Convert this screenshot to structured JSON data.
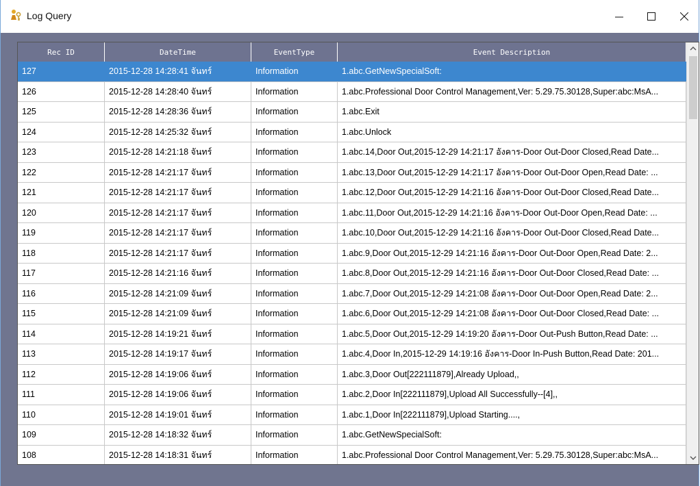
{
  "window": {
    "title": "Log Query",
    "icon": "key-person-icon",
    "controls": {
      "minimize": "—",
      "maximize": "☐",
      "close": "✕"
    }
  },
  "grid": {
    "columns": [
      "Rec ID",
      "DateTime",
      "EventType",
      "Event Description"
    ],
    "selected_index": 0,
    "rows": [
      {
        "rec_id": "127",
        "datetime": "2015-12-28 14:28:41 จันทร์",
        "event_type": "Information",
        "description": "1.abc.GetNewSpecialSoft:"
      },
      {
        "rec_id": "126",
        "datetime": "2015-12-28 14:28:40 จันทร์",
        "event_type": "Information",
        "description": "1.abc.Professional Door Control Management,Ver: 5.29.75.30128,Super:abc:MsA..."
      },
      {
        "rec_id": "125",
        "datetime": "2015-12-28 14:28:36 จันทร์",
        "event_type": "Information",
        "description": "1.abc.Exit"
      },
      {
        "rec_id": "124",
        "datetime": "2015-12-28 14:25:32 จันทร์",
        "event_type": "Information",
        "description": "1.abc.Unlock"
      },
      {
        "rec_id": "123",
        "datetime": "2015-12-28 14:21:18 จันทร์",
        "event_type": "Information",
        "description": "1.abc.14,Door Out,2015-12-29 14:21:17 อังคาร-Door Out-Door Closed,Read Date..."
      },
      {
        "rec_id": "122",
        "datetime": "2015-12-28 14:21:17 จันทร์",
        "event_type": "Information",
        "description": "1.abc.13,Door Out,2015-12-29 14:21:17 อังคาร-Door Out-Door Open,Read Date: ..."
      },
      {
        "rec_id": "121",
        "datetime": "2015-12-28 14:21:17 จันทร์",
        "event_type": "Information",
        "description": "1.abc.12,Door Out,2015-12-29 14:21:16 อังคาร-Door Out-Door Closed,Read Date..."
      },
      {
        "rec_id": "120",
        "datetime": "2015-12-28 14:21:17 จันทร์",
        "event_type": "Information",
        "description": "1.abc.11,Door Out,2015-12-29 14:21:16 อังคาร-Door Out-Door Open,Read Date: ..."
      },
      {
        "rec_id": "119",
        "datetime": "2015-12-28 14:21:17 จันทร์",
        "event_type": "Information",
        "description": "1.abc.10,Door Out,2015-12-29 14:21:16 อังคาร-Door Out-Door Closed,Read Date..."
      },
      {
        "rec_id": "118",
        "datetime": "2015-12-28 14:21:17 จันทร์",
        "event_type": "Information",
        "description": "1.abc.9,Door Out,2015-12-29 14:21:16 อังคาร-Door Out-Door Open,Read Date: 2..."
      },
      {
        "rec_id": "117",
        "datetime": "2015-12-28 14:21:16 จันทร์",
        "event_type": "Information",
        "description": "1.abc.8,Door Out,2015-12-29 14:21:16 อังคาร-Door Out-Door Closed,Read Date: ..."
      },
      {
        "rec_id": "116",
        "datetime": "2015-12-28 14:21:09 จันทร์",
        "event_type": "Information",
        "description": "1.abc.7,Door Out,2015-12-29 14:21:08 อังคาร-Door Out-Door Open,Read Date: 2..."
      },
      {
        "rec_id": "115",
        "datetime": "2015-12-28 14:21:09 จันทร์",
        "event_type": "Information",
        "description": "1.abc.6,Door Out,2015-12-29 14:21:08 อังคาร-Door Out-Door Closed,Read Date: ..."
      },
      {
        "rec_id": "114",
        "datetime": "2015-12-28 14:19:21 จันทร์",
        "event_type": "Information",
        "description": "1.abc.5,Door Out,2015-12-29 14:19:20 อังคาร-Door Out-Push Button,Read Date: ..."
      },
      {
        "rec_id": "113",
        "datetime": "2015-12-28 14:19:17 จันทร์",
        "event_type": "Information",
        "description": "1.abc.4,Door In,2015-12-29 14:19:16 อังคาร-Door In-Push Button,Read Date: 201..."
      },
      {
        "rec_id": "112",
        "datetime": "2015-12-28 14:19:06 จันทร์",
        "event_type": "Information",
        "description": "1.abc.3,Door Out[222111879],Already Upload,,"
      },
      {
        "rec_id": "111",
        "datetime": "2015-12-28 14:19:06 จันทร์",
        "event_type": "Information",
        "description": "1.abc.2,Door In[222111879],Upload All Successfully--[4],,"
      },
      {
        "rec_id": "110",
        "datetime": "2015-12-28 14:19:01 จันทร์",
        "event_type": "Information",
        "description": "1.abc.1,Door In[222111879],Upload Starting....,"
      },
      {
        "rec_id": "109",
        "datetime": "2015-12-28 14:18:32 จันทร์",
        "event_type": "Information",
        "description": "1.abc.GetNewSpecialSoft:"
      },
      {
        "rec_id": "108",
        "datetime": "2015-12-28 14:18:31 จันทร์",
        "event_type": "Information",
        "description": "1.abc.Professional Door Control Management,Ver: 5.29.75.30128,Super:abc:MsA..."
      },
      {
        "rec_id": "",
        "datetime": "",
        "event_type": "",
        "description": ""
      }
    ]
  },
  "colors": {
    "header_bg": "#6e7390",
    "selection_bg": "#3d87cf",
    "window_bg": "#70758f"
  }
}
